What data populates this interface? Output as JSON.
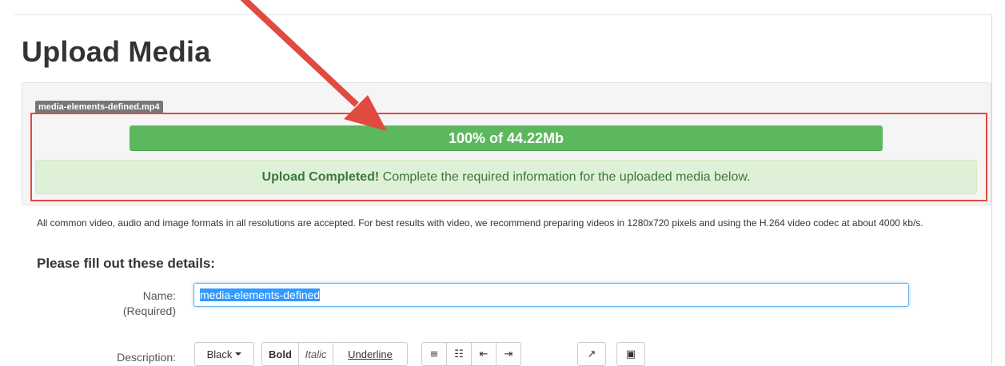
{
  "page": {
    "title": "Upload Media"
  },
  "upload": {
    "file_name": "media-elements-defined.mp4",
    "progress_percent": 100,
    "progress_text": "100% of 44.22Mb",
    "status_strong": "Upload Completed!",
    "status_message": " Complete the required information for the uploaded media below."
  },
  "info": {
    "formats_text": "All common video, audio and image formats in all resolutions are accepted.  For best results with video, we recommend preparing videos in 1280x720 pixels and using the H.264 video codec at about 4000 kb/s."
  },
  "form": {
    "section_title": "Please fill out these details:",
    "name_label": "Name:",
    "name_required": "(Required)",
    "name_value": "media-elements-defined",
    "description_label": "Description:"
  },
  "toolbar": {
    "color_label": "Black",
    "bold_label": "Bold",
    "italic_label": "Italic",
    "underline_label": "Underline",
    "icons": [
      "bullet-list-icon",
      "numbered-list-icon",
      "outdent-icon",
      "indent-icon",
      "link-icon",
      "image-icon"
    ]
  },
  "colors": {
    "progress": "#5cb85c",
    "alert_bg": "#dff0d8",
    "alert_text": "#3c763d",
    "annotation": "#e04a3f",
    "focus": "#66afe9"
  }
}
